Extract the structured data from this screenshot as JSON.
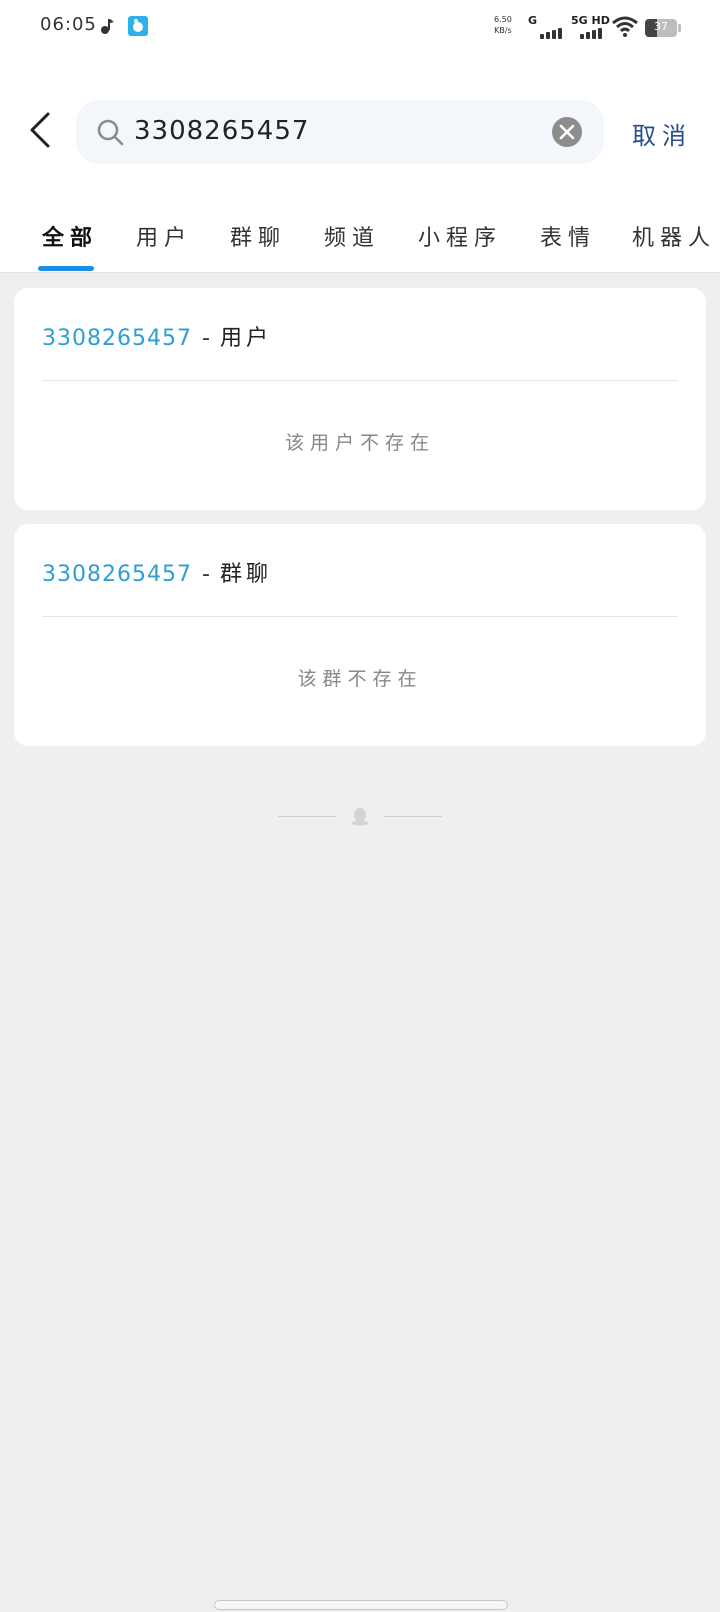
{
  "status_bar": {
    "time": "06:05",
    "net_speed_value": "6.50",
    "net_speed_unit": "KB/s",
    "signal1_label": "G",
    "signal2_label": "5G HD",
    "battery": "37"
  },
  "search": {
    "query": "3308265457",
    "cancel_label": "取消"
  },
  "tabs": [
    {
      "label": "全部",
      "active": true
    },
    {
      "label": "用户"
    },
    {
      "label": "群聊"
    },
    {
      "label": "频道"
    },
    {
      "label": "小程序"
    },
    {
      "label": "表情"
    },
    {
      "label": "机器人"
    }
  ],
  "results": [
    {
      "number": "3308265457",
      "separator": "-",
      "kind": "用户",
      "empty_text": "该用户不存在"
    },
    {
      "number": "3308265457",
      "separator": "-",
      "kind": "群聊",
      "empty_text": "该群不存在"
    }
  ],
  "colors": {
    "accent": "#1a8fe3",
    "number_link": "#2d9fd3",
    "cancel": "#2c4c8a",
    "page_bg": "#eeeff1"
  },
  "icons": [
    "back-arrow-icon",
    "search-icon",
    "clear-icon",
    "penguin-icon",
    "wifi-icon",
    "battery-icon"
  ]
}
